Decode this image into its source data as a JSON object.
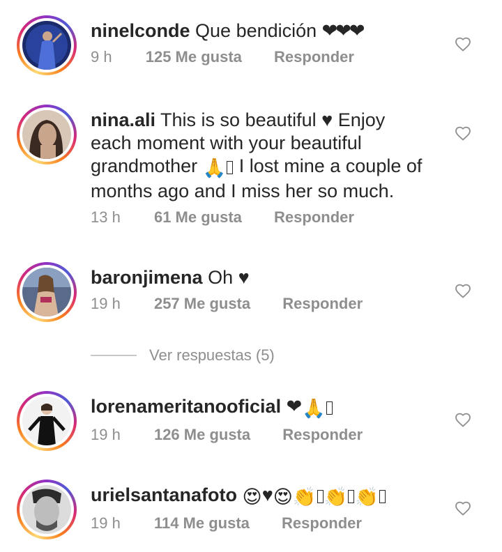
{
  "comments": [
    {
      "username": "ninelconde",
      "text": "Que bendición ❤❤❤",
      "time": "9 h",
      "likes": "125 Me gusta",
      "reply": "Responder",
      "avatar_colors": [
        "#1b2a6b",
        "#4f6fd8"
      ]
    },
    {
      "username": "nina.ali",
      "text": "This is so beautiful ♥ Enjoy each moment with your beautiful grandmother 🙏 I lost mine a couple of months ago and I miss her so much.",
      "time": "13 h",
      "likes": "61 Me gusta",
      "reply": "Responder",
      "avatar_colors": [
        "#3a2a22",
        "#c9a58b"
      ]
    },
    {
      "username": "baronjimena",
      "text": "Oh ♥",
      "time": "19 h",
      "likes": "257 Me gusta",
      "reply": "Responder",
      "avatar_colors": [
        "#5a6a8a",
        "#d9b59a"
      ]
    },
    {
      "username": "lorenameritanooficial",
      "text": "❤🙏",
      "time": "19 h",
      "likes": "126 Me gusta",
      "reply": "Responder",
      "avatar_colors": [
        "#f2f2f2",
        "#111111"
      ]
    },
    {
      "username": "urielsantanafoto",
      "text": "😍♥😍👏👏👏",
      "time": "19 h",
      "likes": "114 Me gusta",
      "reply": "Responder",
      "avatar_colors": [
        "#2b2b2b",
        "#bdbdbd"
      ]
    }
  ],
  "view_replies": "Ver respuestas (5)"
}
